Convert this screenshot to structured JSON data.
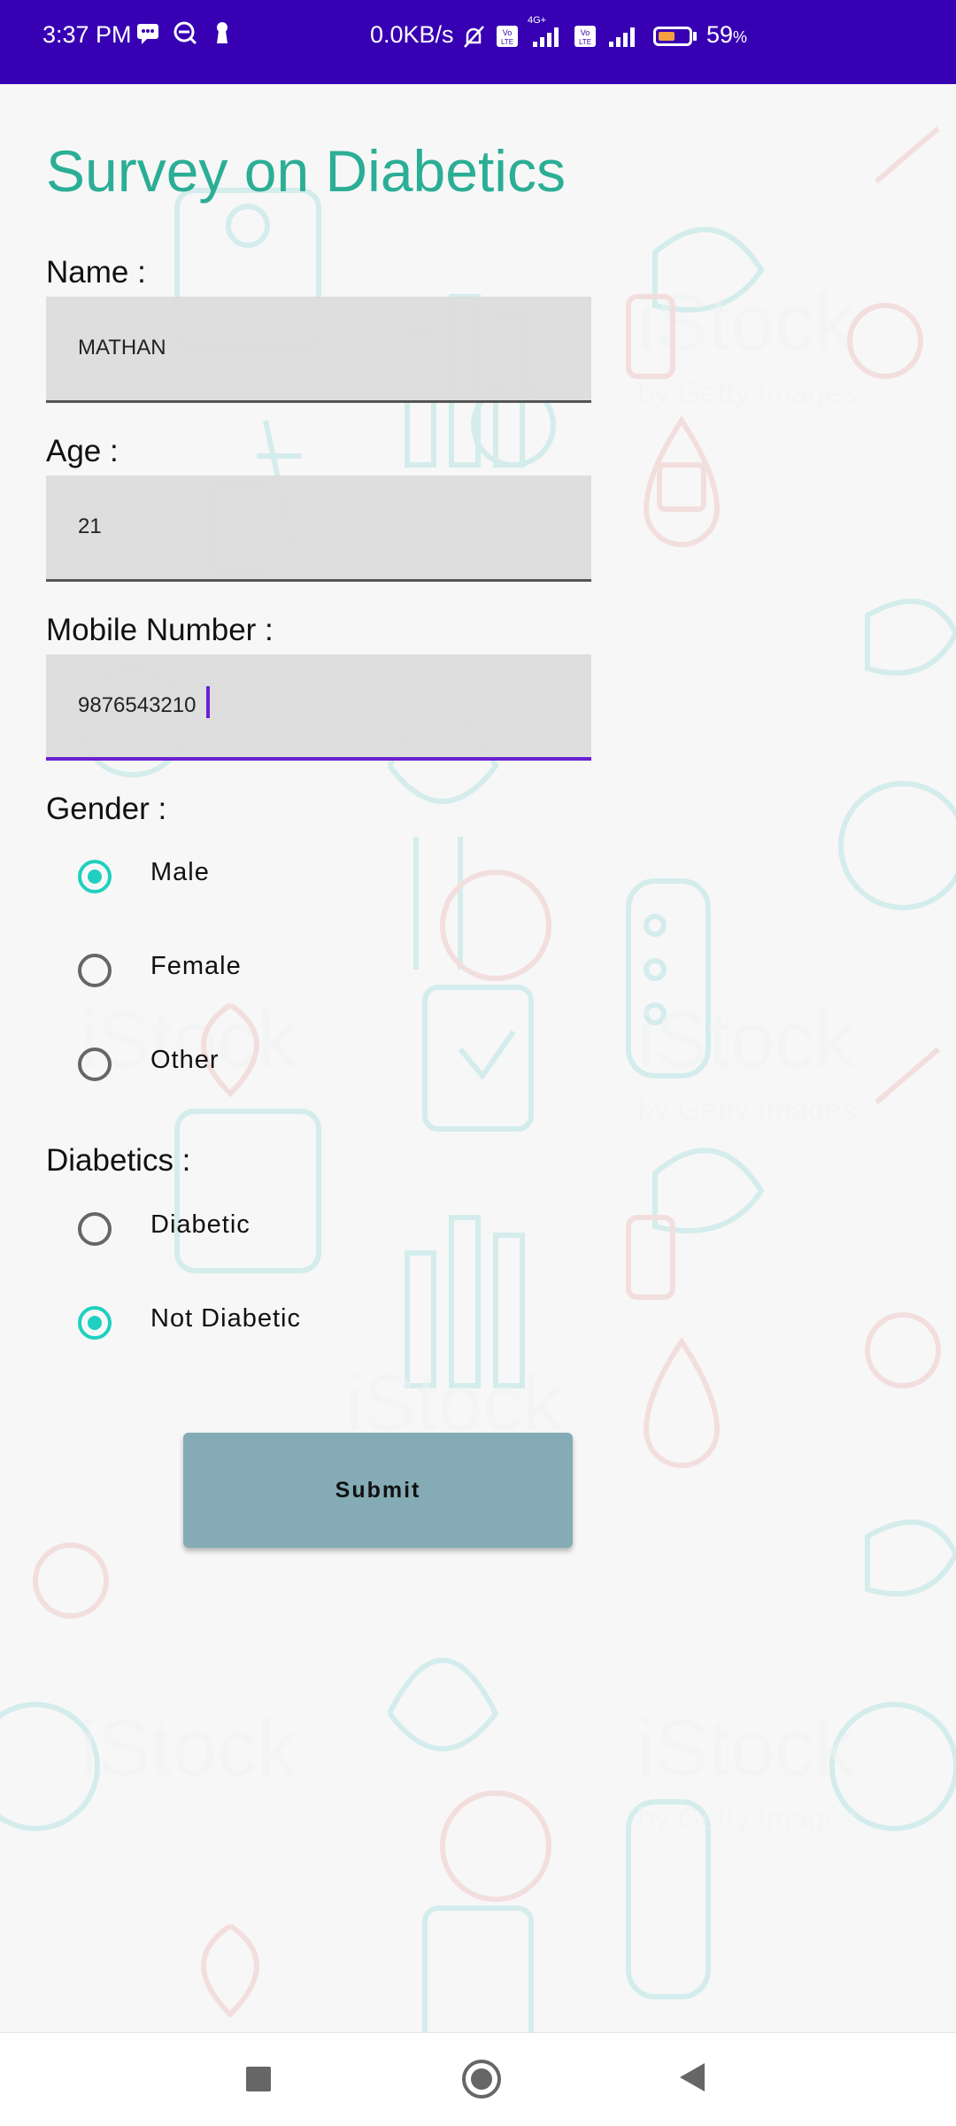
{
  "status_bar": {
    "time": "3:37 PM",
    "network_speed": "0.0KB/s",
    "network_type": "4G+",
    "battery_percent": "59",
    "battery_suffix": "%"
  },
  "title": "Survey on Diabetics",
  "fields": {
    "name": {
      "label": "Name :",
      "value": "MATHAN"
    },
    "age": {
      "label": "Age :",
      "value": "21"
    },
    "mobile": {
      "label": "Mobile Number :",
      "value": "9876543210"
    }
  },
  "gender": {
    "label": "Gender :",
    "options": [
      "Male",
      "Female",
      "Other"
    ],
    "selected": "Male"
  },
  "diabetics": {
    "label": "Diabetics :",
    "options": [
      "Diabetic",
      "Not Diabetic"
    ],
    "selected": "Not Diabetic"
  },
  "submit_label": "Submit",
  "watermark": "iStock",
  "watermark_sub": "by Getty Images",
  "colors": {
    "status_bar": "#3700b3",
    "title": "#2bae95",
    "radio_checked": "#1fd0c0",
    "active_underline": "#6a1fd2",
    "submit_bg": "#85acb6"
  }
}
